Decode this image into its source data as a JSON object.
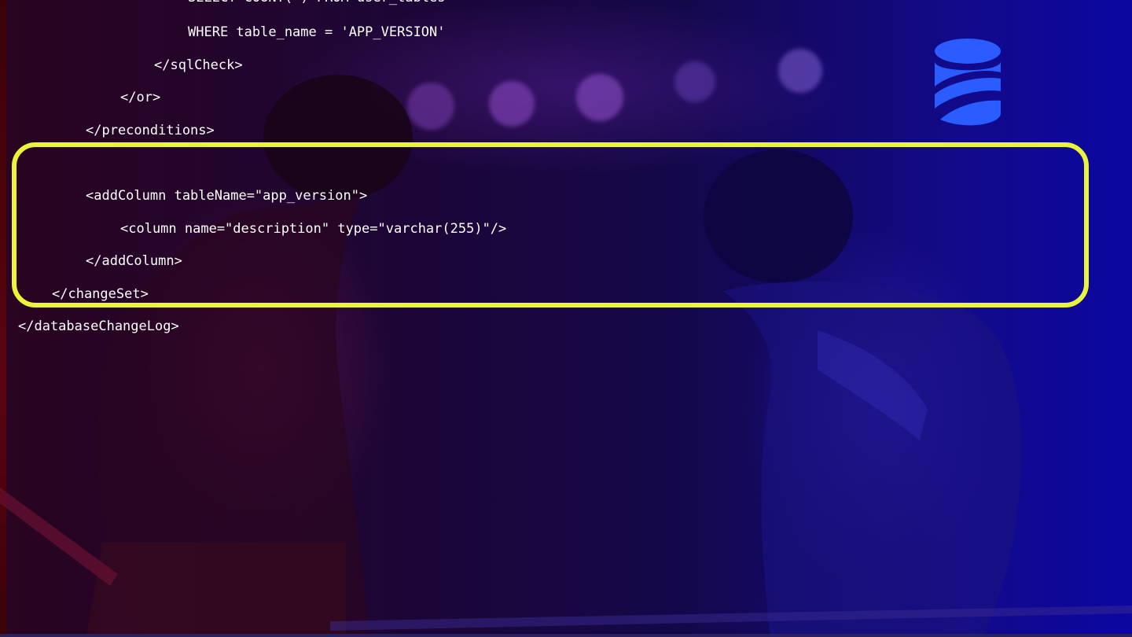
{
  "slide": {
    "accent_color": "#eaf53a",
    "logo_icon": "liquibase-database-logo",
    "code_lines": [
      "SELECT COUNT(*) FROM user_tables",
      "WHERE table_name = 'APP_VERSION'",
      "</sqlCheck>",
      "</or>",
      "</preconditions>",
      "<addColumn tableName=\"app_version\">",
      "<column name=\"description\" type=\"varchar(255)\"/>",
      "</addColumn>",
      "</changeSet>",
      "</databaseChangeLog>"
    ]
  }
}
